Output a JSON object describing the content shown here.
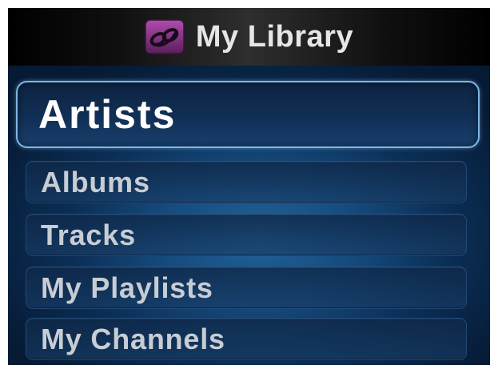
{
  "header": {
    "title": "My Library",
    "icon": "music-notes-icon",
    "icon_color": "#7a2b7a"
  },
  "menu": {
    "selected_index": 0,
    "items": [
      {
        "label": "Artists"
      },
      {
        "label": "Albums"
      },
      {
        "label": "Tracks"
      },
      {
        "label": "My Playlists"
      },
      {
        "label": "My Channels"
      }
    ]
  },
  "colors": {
    "background": "#154a7c",
    "highlight_border": "#7fb6e4",
    "label_text": "#c8cdd4",
    "selected_text": "#ffffff"
  }
}
